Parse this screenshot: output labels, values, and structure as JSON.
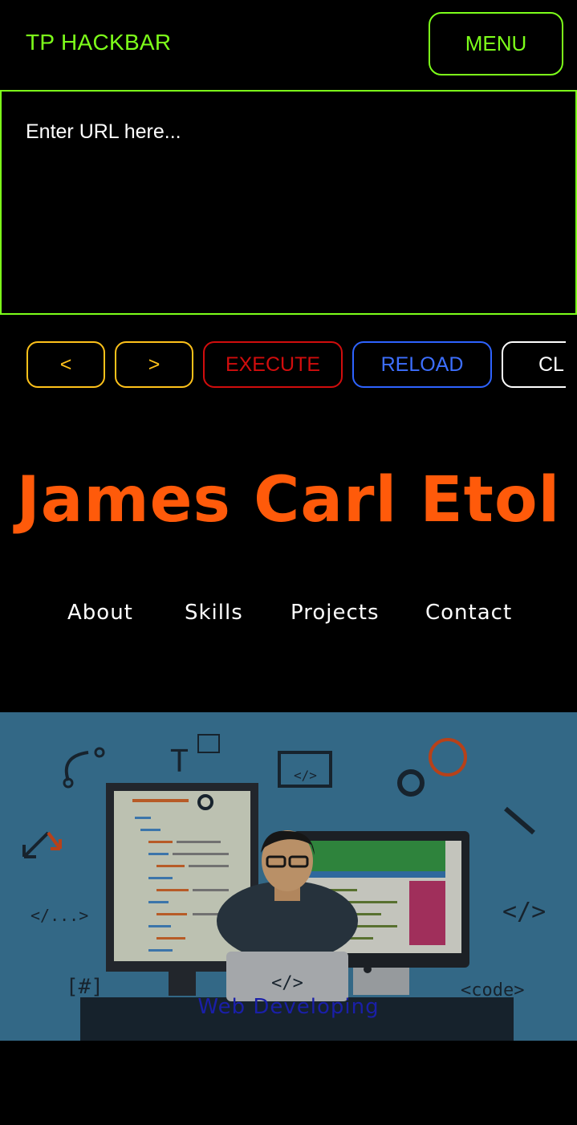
{
  "hackbar": {
    "title": "TP HACKBAR",
    "menu_label": "MENU",
    "url_placeholder": "Enter URL here...",
    "buttons": {
      "prev": "<",
      "next": ">",
      "execute": "EXECUTE",
      "reload": "RELOAD",
      "clear": "CL"
    }
  },
  "site": {
    "name": "James Carl Etol",
    "nav": {
      "about": "About",
      "skills": "Skills",
      "projects": "Projects",
      "contact": "Contact"
    },
    "hero": {
      "caption": "Web Developing",
      "glyphs": {
        "tag_left": "</...>",
        "tag_right": "</>",
        "hash": "[#]",
        "code": "<code>",
        "laptop": "</>",
        "window": "</>",
        "t": "T"
      }
    }
  },
  "colors": {
    "hackbar_accent": "#7dff1a",
    "nav_buttons": "#ffc21a",
    "execute": "#d10d0d",
    "reload": "#2e63ff",
    "name": "#ff5a0a",
    "hero_bg": "#3f7fa4",
    "caption": "#1a1fa8"
  }
}
